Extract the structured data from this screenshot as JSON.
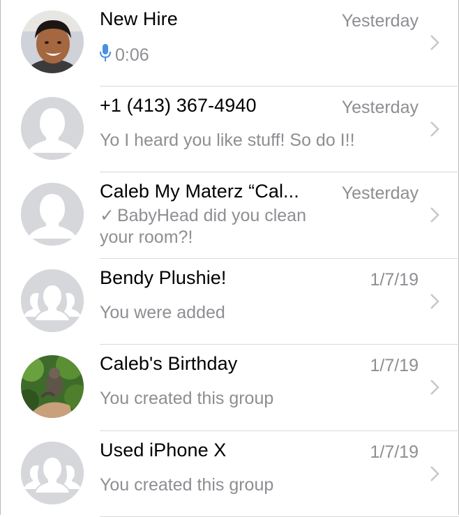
{
  "colors": {
    "name_text": "#000000",
    "secondary_text": "#8e8e93",
    "mic_blue": "#4a90e2",
    "placeholder_avatar_bg": "#d6d7db",
    "separator": "#d9d9d9"
  },
  "chats": [
    {
      "name": "New Hire",
      "date": "Yesterday",
      "preview": "0:06",
      "preview_icon": "microphone-icon",
      "avatar": "photo-boy"
    },
    {
      "name": "+1 (413) 367-4940",
      "date": "Yesterday",
      "preview": "Yo I heard you like stuff! So do I!!",
      "avatar": "default-person"
    },
    {
      "name": "Caleb My Materz “Cal...",
      "date": "Yesterday",
      "preview_check": "✓",
      "preview": "BabyHead did you clean your room?!",
      "preview_icon": "checkmark-icon",
      "avatar": "default-person"
    },
    {
      "name": "Bendy Plushie!",
      "date": "1/7/19",
      "preview": "You were added",
      "avatar": "default-group"
    },
    {
      "name": "Caleb's Birthday",
      "date": "1/7/19",
      "preview": "You created this group",
      "avatar": "photo-monkey"
    },
    {
      "name": "Used iPhone X",
      "date": "1/7/19",
      "preview": "You created this group",
      "avatar": "default-group"
    }
  ]
}
